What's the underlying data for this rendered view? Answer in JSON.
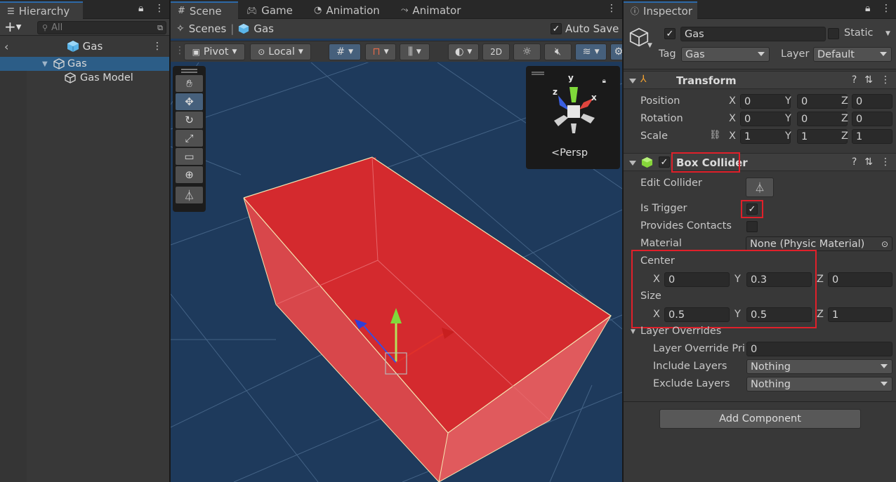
{
  "hierarchy": {
    "tab_label": "Hierarchy",
    "search_placeholder": "All",
    "scene_name": "Gas",
    "items": [
      {
        "label": "Gas"
      },
      {
        "label": "Gas Model"
      }
    ]
  },
  "scene_view": {
    "tabs": [
      {
        "label": "Scene"
      },
      {
        "label": "Game"
      },
      {
        "label": "Animation"
      },
      {
        "label": "Animator"
      }
    ],
    "breadcrumb": {
      "root": "Scenes",
      "separator": "|",
      "current": "Gas"
    },
    "auto_save_label": "Auto Save",
    "auto_save_checked": true,
    "toolbar": {
      "pivot_label": "Pivot",
      "local_label": "Local",
      "mode_2d_label": "2D"
    },
    "gizmo": {
      "persp_label": "<Persp",
      "axis_y": "y",
      "axis_x": "x",
      "axis_z": "z"
    }
  },
  "inspector": {
    "tab_label": "Inspector",
    "object": {
      "active_checked": true,
      "name": "Gas",
      "static_label": "Static",
      "static_checked": false,
      "tag_label": "Tag",
      "tag_value": "Gas",
      "layer_label": "Layer",
      "layer_value": "Default"
    },
    "transform": {
      "title": "Transform",
      "position_label": "Position",
      "rotation_label": "Rotation",
      "scale_label": "Scale",
      "axis_x": "X",
      "axis_y": "Y",
      "axis_z": "Z",
      "position": {
        "x": "0",
        "y": "0",
        "z": "0"
      },
      "rotation": {
        "x": "0",
        "y": "0",
        "z": "0"
      },
      "scale": {
        "x": "1",
        "y": "1",
        "z": "1"
      }
    },
    "box_collider": {
      "title": "Box Collider",
      "enabled_checked": true,
      "edit_collider_label": "Edit Collider",
      "is_trigger_label": "Is Trigger",
      "is_trigger_checked": true,
      "provides_contacts_label": "Provides Contacts",
      "provides_contacts_checked": false,
      "material_label": "Material",
      "material_value": "None (Physic Material)",
      "center_label": "Center",
      "center": {
        "x": "0",
        "y": "0.3",
        "z": "0"
      },
      "size_label": "Size",
      "size": {
        "x": "0.5",
        "y": "0.5",
        "z": "1"
      },
      "layer_overrides_label": "Layer Overrides",
      "layer_override_priority_label": "Layer Override Pri",
      "layer_override_priority_value": "0",
      "include_layers_label": "Include Layers",
      "include_layers_value": "Nothing",
      "exclude_layers_label": "Exclude Layers",
      "exclude_layers_value": "Nothing"
    },
    "add_component_label": "Add Component"
  },
  "colors": {
    "selection": "#2c5d87",
    "highlight_box": "#e0202a",
    "collider_fill": "#d42a2e",
    "scene_background": "#1e3a5c"
  }
}
